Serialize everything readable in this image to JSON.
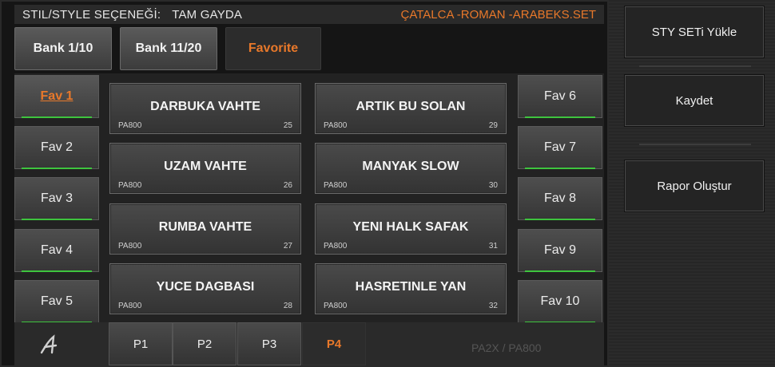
{
  "header": {
    "label": "STIL/STYLE SEÇENEĞİ:",
    "mode": "TAM GAYDA",
    "set_name": "ÇATALCA -ROMAN -ARABEKS.SET"
  },
  "bank_tabs": [
    {
      "label": "Bank 1/10"
    },
    {
      "label": "Bank 11/20"
    },
    {
      "label": "Favorite"
    }
  ],
  "favorites_left": [
    {
      "label": "Fav 1"
    },
    {
      "label": "Fav 2"
    },
    {
      "label": "Fav 3"
    },
    {
      "label": "Fav 4"
    },
    {
      "label": "Fav 5"
    }
  ],
  "favorites_right": [
    {
      "label": "Fav 6"
    },
    {
      "label": "Fav 7"
    },
    {
      "label": "Fav 8"
    },
    {
      "label": "Fav 9"
    },
    {
      "label": "Fav 10"
    }
  ],
  "styles": [
    {
      "name": "DARBUKA VAHTE",
      "model": "PA800",
      "num": "25"
    },
    {
      "name": "UZAM VAHTE",
      "model": "PA800",
      "num": "26"
    },
    {
      "name": "RUMBA  VAHTE",
      "model": "PA800",
      "num": "27"
    },
    {
      "name": "YUCE DAGBASI",
      "model": "PA800",
      "num": "28"
    },
    {
      "name": "ARTIK BU SOLAN",
      "model": "PA800",
      "num": "29"
    },
    {
      "name": "MANYAK SLOW",
      "model": "PA800",
      "num": "30"
    },
    {
      "name": "YENI HALK SAFAK",
      "model": "PA800",
      "num": "31"
    },
    {
      "name": "HASRETINLE YAN",
      "model": "PA800",
      "num": "32"
    }
  ],
  "pages": [
    {
      "label": "P1"
    },
    {
      "label": "P2"
    },
    {
      "label": "P3"
    },
    {
      "label": "P4"
    }
  ],
  "device_label": "PA2X / PA800",
  "sidebar": {
    "load_label": "STY  SETi  Yükle",
    "save_label": "Kaydet",
    "report_label": "Rapor Oluştur"
  },
  "colors": {
    "accent": "#e8782a",
    "indicator": "#3ec43e"
  },
  "icons": {
    "logo": "script-a-logo-icon"
  }
}
